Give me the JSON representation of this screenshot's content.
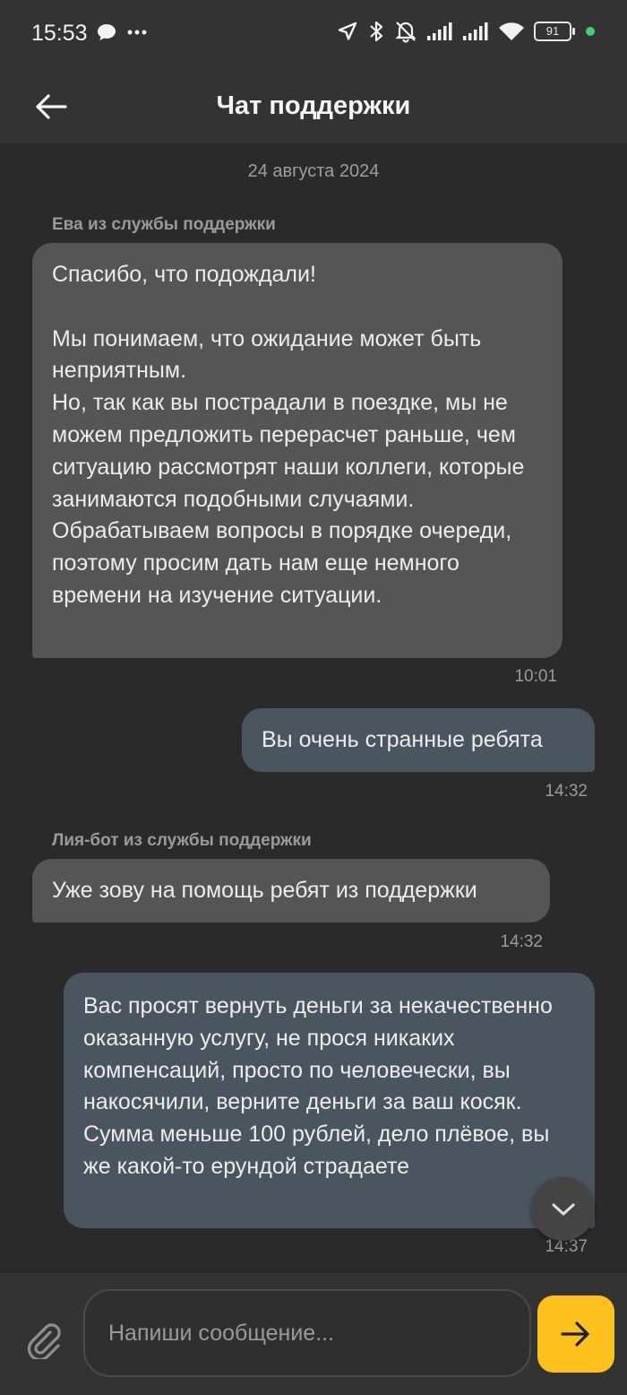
{
  "status_bar": {
    "time": "15:53",
    "battery": "91",
    "icons": [
      "chat-bubble-icon",
      "more-dots-icon",
      "location-arrow-icon",
      "bluetooth-icon",
      "mute-bell-icon",
      "signal-icon",
      "signal-icon",
      "wifi-icon",
      "battery-icon"
    ]
  },
  "header": {
    "title": "Чат поддержки",
    "back_icon": "arrow-left-icon"
  },
  "chat": {
    "date_separator": "24 августа 2024",
    "messages": [
      {
        "sender": "Ева из службы поддержки",
        "direction": "incoming",
        "text": "Спасибо, что подождали!\n\nМы понимаем, что ожидание может быть неприятным.\nНо, так как вы пострадали в поездке, мы не можем предложить перерасчет раньше, чем ситуацию рассмотрят наши коллеги, которые занимаются подобными случаями.\nОбрабатываем вопросы в порядке очереди, поэтому просим дать нам еще немного времени на изучение ситуации.",
        "time": "10:01"
      },
      {
        "direction": "outgoing",
        "text": "Вы очень странные ребята",
        "time": "14:32"
      },
      {
        "sender": "Лия-бот из службы поддержки",
        "direction": "incoming",
        "text": "Уже зову на помощь ребят из поддержки",
        "time": "14:32"
      },
      {
        "direction": "outgoing",
        "text": "Вас просят вернуть деньги за некачественно оказанную услугу, не прося никаких компенсаций, просто по человечески, вы накосячили, верните деньги за ваш косяк. Сумма меньше 100 рублей, дело плёвое, вы же какой-то ерундой страдаете",
        "time": "14:37"
      }
    ]
  },
  "composer": {
    "placeholder": "Напиши сообщение...",
    "attach_icon": "paperclip-icon",
    "send_icon": "arrow-right-icon",
    "send_color": "#fcc21b"
  }
}
